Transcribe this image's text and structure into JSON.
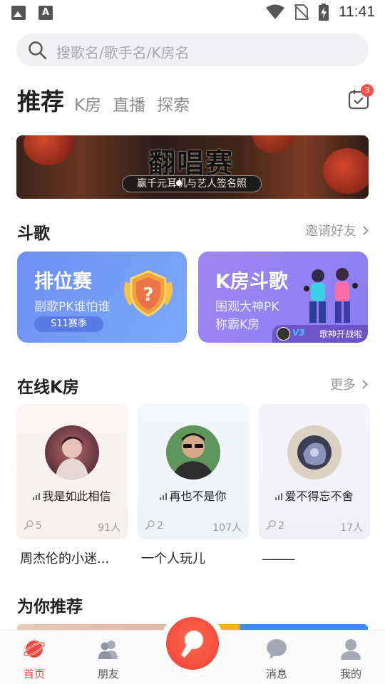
{
  "status_bar": {
    "time": "11:41"
  },
  "search": {
    "placeholder": "搜歌名/歌手名/K房名"
  },
  "tabs": [
    {
      "label": "推荐",
      "active": true
    },
    {
      "label": "K房"
    },
    {
      "label": "直播"
    },
    {
      "label": "探索"
    }
  ],
  "calendar": {
    "badge": "3"
  },
  "banner": {
    "title": "翻唱赛",
    "subtitle": "赢千元耳机与艺人签名照"
  },
  "battle_section": {
    "title": "斗歌",
    "link": "邀请好友",
    "rank_card": {
      "title": "排位赛",
      "subtitle": "副歌PK谁怕谁",
      "season": "S11赛季",
      "shield_symbol": "?"
    },
    "room_card": {
      "title": "K房斗歌",
      "line1": "围观大神PK",
      "line2": "称霸K房",
      "tag": "V3",
      "promo": "歌神开战啦"
    }
  },
  "online_section": {
    "title": "在线K房",
    "link": "更多",
    "rooms": [
      {
        "song": "我是如此相信",
        "mic_count": "5",
        "people": "91人",
        "name": "周杰伦的小迷..."
      },
      {
        "song": "再也不是你",
        "mic_count": "2",
        "people": "107人",
        "name": "一个人玩儿"
      },
      {
        "song": "爱不得忘不舍",
        "mic_count": "2",
        "people": "17人",
        "name": "_____"
      }
    ]
  },
  "recommend_section": {
    "title": "为你推荐"
  },
  "bottom_nav": {
    "home": "首页",
    "friends": "朋友",
    "messages": "消息",
    "me": "我的",
    "active_color": "#f04a3f"
  }
}
